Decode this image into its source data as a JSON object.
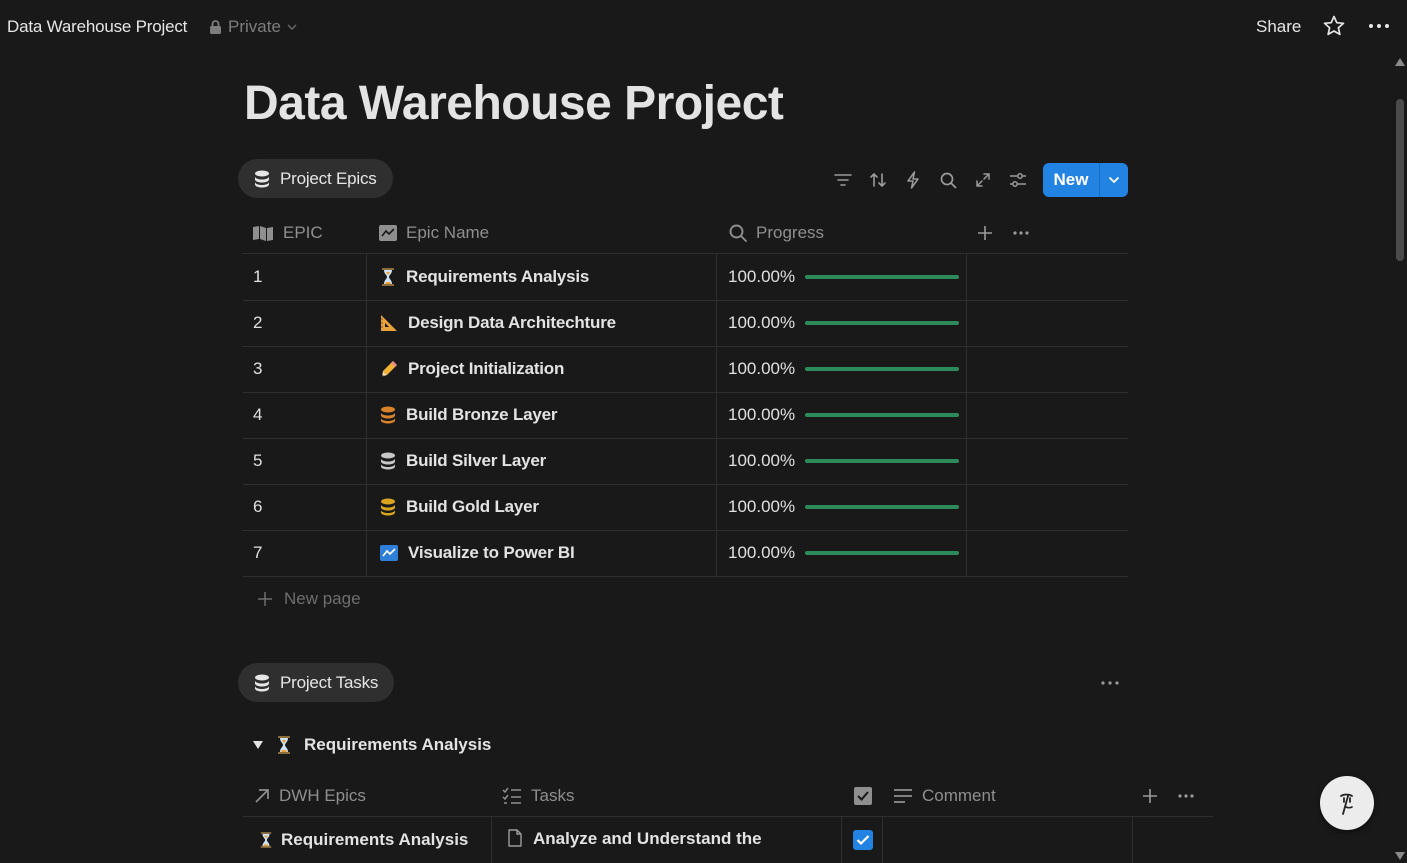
{
  "topbar": {
    "breadcrumb": "Data Warehouse Project",
    "privacy": "Private",
    "share_label": "Share"
  },
  "page": {
    "title": "Data Warehouse Project"
  },
  "epics_db": {
    "view_label": "Project Epics",
    "new_button": "New",
    "columns": [
      "EPIC",
      "Epic Name",
      "Progress"
    ],
    "rows": [
      {
        "epic": "1",
        "name": "Requirements Analysis",
        "icon": "hourglass-icon",
        "progress_text": "100.00%",
        "progress": 1.0
      },
      {
        "epic": "2",
        "name": "Design Data Architechture",
        "icon": "triangular-ruler-icon",
        "progress_text": "100.00%",
        "progress": 1.0
      },
      {
        "epic": "3",
        "name": "Project Initialization",
        "icon": "pencil-icon",
        "progress_text": "100.00%",
        "progress": 1.0
      },
      {
        "epic": "4",
        "name": "Build Bronze Layer",
        "icon": "database-icon",
        "progress_text": "100.00%",
        "progress": 1.0
      },
      {
        "epic": "5",
        "name": "Build Silver Layer",
        "icon": "database-icon",
        "progress_text": "100.00%",
        "progress": 1.0
      },
      {
        "epic": "6",
        "name": "Build Gold Layer",
        "icon": "database-icon",
        "progress_text": "100.00%",
        "progress": 1.0
      },
      {
        "epic": "7",
        "name": "Visualize to Power BI",
        "icon": "chart-icon",
        "progress_text": "100.00%",
        "progress": 1.0
      }
    ],
    "new_page_label": "New page"
  },
  "tasks_db": {
    "view_label": "Project Tasks",
    "group_label": "Requirements Analysis",
    "columns": [
      "DWH Epics",
      "Tasks",
      "Comment"
    ],
    "rows": [
      {
        "epic": "Requirements Analysis",
        "task": "Analyze and Understand the",
        "done": true
      }
    ]
  },
  "colors": {
    "background": "#191919",
    "accent": "#2383e2",
    "progress": "#2d8a5a",
    "bronze": "#d9822b",
    "silver": "#c8c8c8",
    "gold": "#d9a520"
  }
}
